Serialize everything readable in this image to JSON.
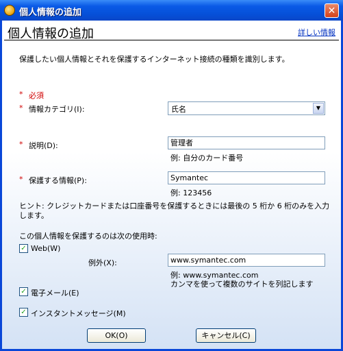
{
  "window": {
    "title": "個人情報の追加",
    "close_glyph": "✕"
  },
  "header": {
    "title": "個人情報の追加",
    "details_link": "詳しい情報"
  },
  "intro": "保護したい個人情報とそれを保護するインターネット接続の種類を識別します。",
  "required_legend": "必須",
  "asterisk": "*",
  "category": {
    "label": "情報カテゴリ(I):",
    "value": "氏名"
  },
  "description": {
    "label": "説明(D):",
    "value": "管理者",
    "example": "例: 自分のカード番号"
  },
  "protected_info": {
    "label": "保護する情報(P):",
    "value": "Symantec",
    "example": "例: 123456"
  },
  "hint": "ヒント: クレジットカードまたは口座番号を保護するときには最後の 5 桁か 6 桁のみを入力します。",
  "usage_heading": "この個人情報を保護するのは次の使用時:",
  "web": {
    "label": "Web(W)",
    "checked": true
  },
  "exceptions": {
    "label": "例外(X):",
    "value": "www.symantec.com",
    "example1": "例: www.symantec.com",
    "example2": "カンマを使って複数のサイトを列記します"
  },
  "email": {
    "label": "電子メール(E)",
    "checked": true
  },
  "im": {
    "label": "インスタントメッセージ(M)",
    "checked": true
  },
  "buttons": {
    "ok": "OK(O)",
    "cancel": "キャンセル(C)"
  },
  "check_glyph": "✓",
  "colors": {
    "titlebar": "#0550d8",
    "required": "#d00000",
    "link": "#0030c0"
  }
}
